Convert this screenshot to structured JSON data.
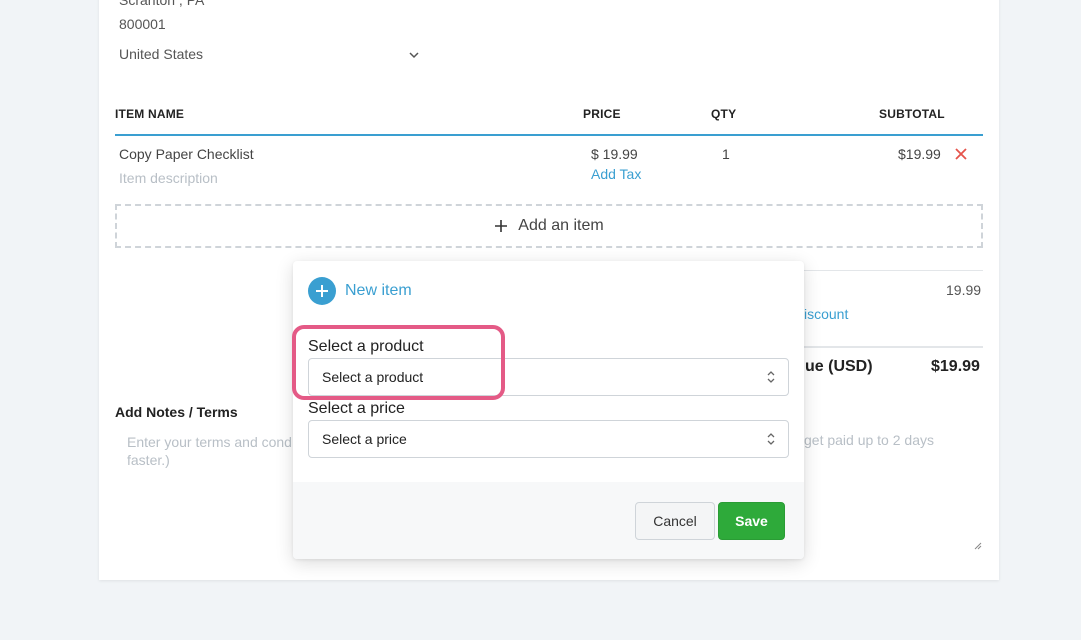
{
  "address": {
    "city_state": "Scranton , PA",
    "zip": "800001",
    "country": "United States"
  },
  "table": {
    "headers": [
      "ITEM NAME",
      "PRICE",
      "QTY",
      "SUBTOTAL"
    ],
    "rows": [
      {
        "name": "Copy Paper Checklist",
        "description_placeholder": "Item description",
        "price": "$  19.99",
        "add_tax": "Add Tax",
        "qty": "1",
        "subtotal": "$19.99"
      }
    ],
    "add_item_label": "Add an item"
  },
  "totals": {
    "subtotal_value": "19.99",
    "discount_link": "iscount",
    "due_label": "ue (USD)",
    "due_value": "$19.99"
  },
  "notes": {
    "title": "Add Notes / Terms",
    "placeholder_left_1": "Enter your terms and cond",
    "placeholder_left_2": "faster.)",
    "placeholder_right": "get paid up to 2 days"
  },
  "popup": {
    "new_item_label": "New item",
    "product_label": "Select a product",
    "product_select_value": "Select a product",
    "price_label": "Select a price",
    "price_select_value": "Select a price",
    "cancel_label": "Cancel",
    "save_label": "Save"
  },
  "colors": {
    "accent": "#3a9fd1",
    "save_green": "#2eaa3a",
    "highlight_pink": "#e45a86",
    "remove_red": "#e5534b"
  }
}
